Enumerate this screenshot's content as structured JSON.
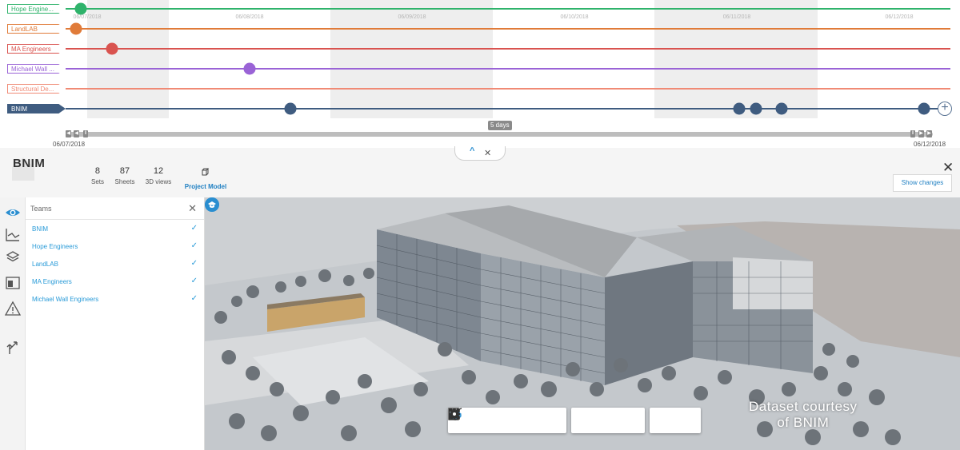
{
  "timeline": {
    "dates": [
      "06/07/2018",
      "06/08/2018",
      "06/09/2018",
      "06/10/2018",
      "06/11/2018",
      "06/12/2018"
    ],
    "lanes": [
      {
        "label": "Hope Engine...",
        "color": "#2fb36b",
        "active": false
      },
      {
        "label": "LandLAB",
        "color": "#e07b39",
        "active": false
      },
      {
        "label": "MA Engineers",
        "color": "#d9534f",
        "active": false
      },
      {
        "label": "Michael Wall ...",
        "color": "#9a63d6",
        "active": false
      },
      {
        "label": "Structural De...",
        "color": "#f08a75",
        "active": false
      },
      {
        "label": "BNIM",
        "color": "#3f5c80",
        "active": true
      }
    ],
    "range_badge": "5 days",
    "range_start": "06/07/2018",
    "range_end": "06/12/2018"
  },
  "header": {
    "project": "BNIM",
    "stats": [
      {
        "num": "8",
        "label": "Sets"
      },
      {
        "num": "87",
        "label": "Sheets"
      },
      {
        "num": "12",
        "label": "3D views"
      }
    ],
    "model_label": "Project Model",
    "show_changes": "Show changes",
    "close_symbol": "✕"
  },
  "rail": {
    "icons": [
      "eye-icon",
      "chart-icon",
      "layers-icon",
      "sheets-icon",
      "warning-icon",
      "branch-icon"
    ]
  },
  "teams": {
    "title": "Teams",
    "close_symbol": "✕",
    "check_symbol": "✓",
    "items": [
      "BNIM",
      "Hope Engineers",
      "LandLAB",
      "MA Engineers",
      "Michael Wall Engineers"
    ]
  },
  "viewport": {
    "watermark_line1": "Dataset courtesy",
    "watermark_line2": "of BNIM",
    "accent": "#2a8ed0"
  },
  "collapse": {
    "up_symbol": "^",
    "close_symbol": "✕"
  }
}
